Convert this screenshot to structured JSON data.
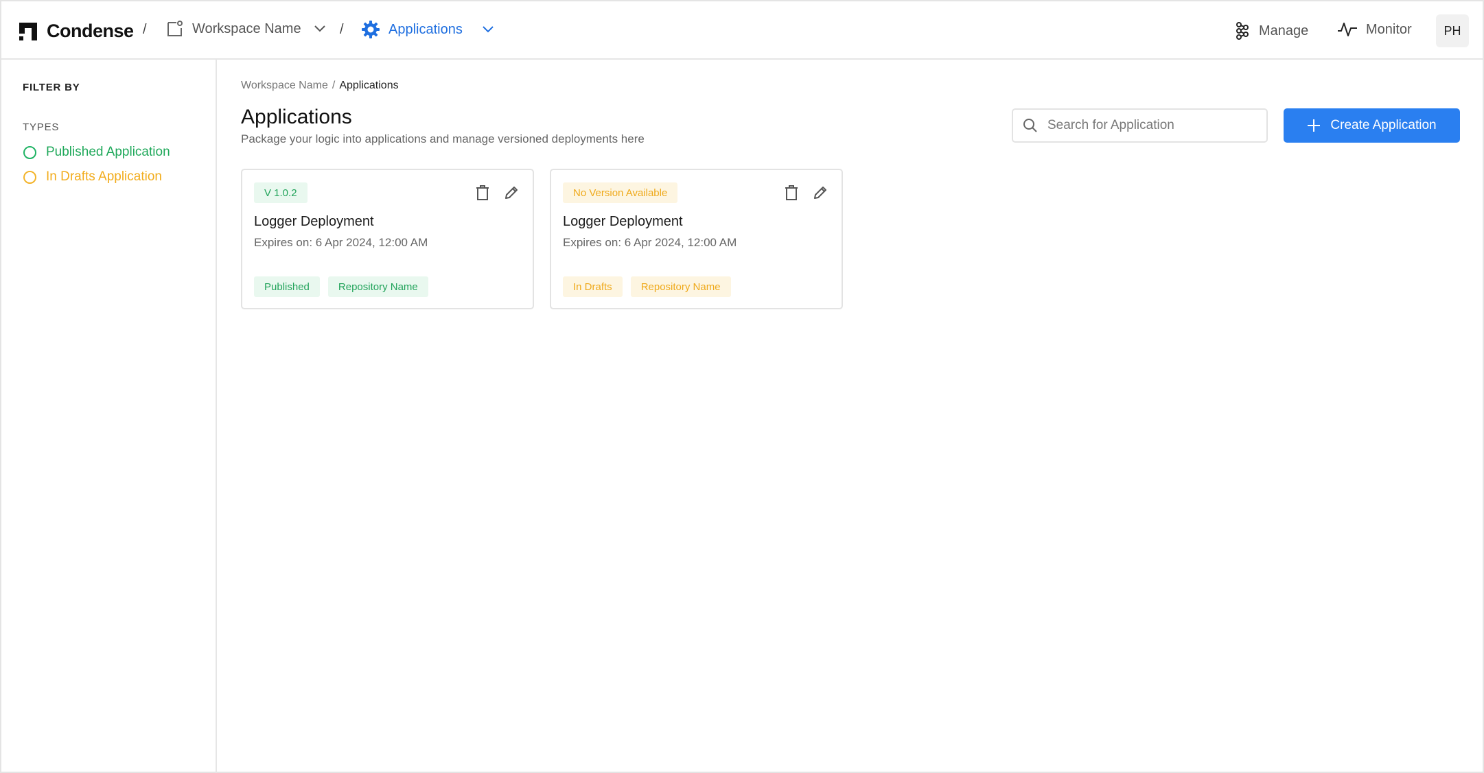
{
  "header": {
    "brand": "Condense",
    "separator": "/",
    "workspace": "Workspace Name",
    "current_section": "Applications",
    "nav": {
      "manage": "Manage",
      "monitor": "Monitor"
    },
    "avatar_initials": "PH"
  },
  "sidebar": {
    "filter_title": "FILTER BY",
    "types_title": "TYPES",
    "options": [
      {
        "label": "Published Application",
        "color": "#1fa85a"
      },
      {
        "label": "In Drafts Application",
        "color": "#f2ac1c"
      }
    ]
  },
  "main": {
    "breadcrumb": {
      "parent": "Workspace Name",
      "sep": "/",
      "current": "Applications"
    },
    "title": "Applications",
    "subtitle": "Package your logic into applications and manage versioned deployments here",
    "search": {
      "placeholder": "Search for Application",
      "value": ""
    },
    "create_button": "Create Application",
    "cards": [
      {
        "version": "V 1.0.2",
        "title": "Logger Deployment",
        "expires": "Expires on: 6 Apr 2024, 12:00 AM",
        "status": "Published",
        "repository": "Repository Name"
      },
      {
        "version": "No Version Available",
        "title": "Logger Deployment",
        "expires": "Expires on: 6 Apr 2024, 12:00 AM",
        "status": "In Drafts",
        "repository": "Repository Name"
      }
    ]
  },
  "colors": {
    "accent": "#2a7ff0",
    "published": "#21a35a",
    "draft": "#efa91a"
  }
}
